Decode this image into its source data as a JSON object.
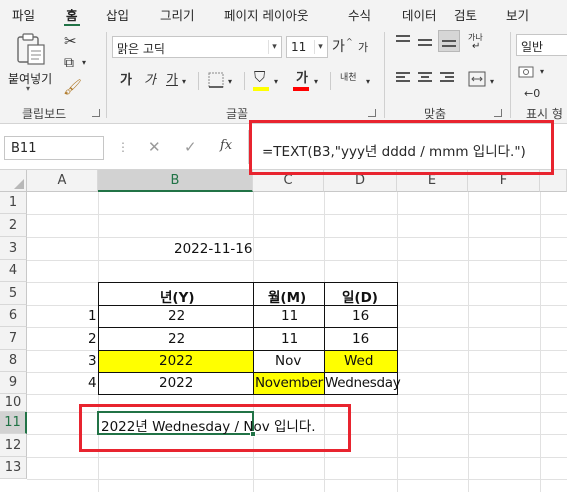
{
  "menu": {
    "tabs": [
      "파일",
      "홈",
      "삽입",
      "그리기",
      "페이지 레이아웃",
      "수식",
      "데이터",
      "검토",
      "보기"
    ],
    "active": "홈"
  },
  "ribbon": {
    "clipboard": {
      "paste_label": "붙여넣기",
      "group_label": "클립보드"
    },
    "font": {
      "font_name": "맑은 고딕",
      "font_size": "11",
      "grow_label": "가",
      "shrink_label": "가",
      "bold": "가",
      "italic": "가",
      "underline": "가",
      "font_color_label": "가",
      "phonetic_label": "내천",
      "group_label": "글꼴",
      "font_color": "#ff0000",
      "fill_color": "#ffff00"
    },
    "alignment": {
      "wrap_label": "가나",
      "group_label": "맞춤"
    },
    "number": {
      "format": "일반",
      "group_label": "표시 형"
    }
  },
  "formula_bar": {
    "name_box": "B11",
    "formula": "=TEXT(B3,\"yyy년 dddd / mmm 입니다.\")",
    "fx_label": "fx"
  },
  "grid": {
    "columns": [
      "A",
      "B",
      "C",
      "D",
      "E",
      "F"
    ],
    "rows": [
      "1",
      "2",
      "3",
      "4",
      "5",
      "6",
      "7",
      "8",
      "9",
      "10",
      "11",
      "12",
      "13"
    ],
    "selected_cell": "B11"
  },
  "cells": {
    "B3": "2022-11-16",
    "B5": "년(Y)",
    "C5": "월(M)",
    "D5": "일(D)",
    "A6": "1",
    "B6": "22",
    "C6": "11",
    "D6": "16",
    "A7": "2",
    "B7": "22",
    "C7": "11",
    "D7": "16",
    "A8": "3",
    "B8": "2022",
    "C8": "Nov",
    "D8": "Wed",
    "A9": "4",
    "B9": "2022",
    "C9": "November",
    "D9": "Wednesday",
    "B11": "2022년 Wednesday / Nov 입니다."
  },
  "colors": {
    "accent": "#217346",
    "highlight": "#ffff00",
    "annotation": "#e8242f"
  }
}
